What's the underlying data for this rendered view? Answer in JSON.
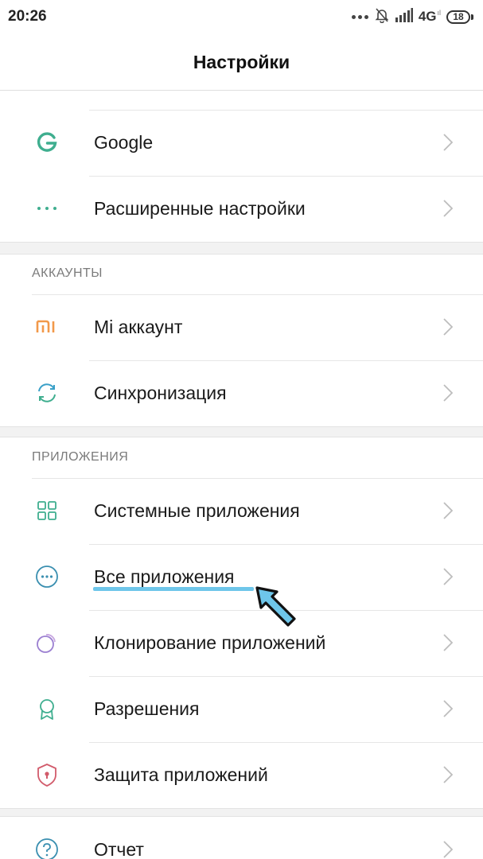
{
  "status_bar": {
    "time": "20:26",
    "network": "4G",
    "network_sub": "ıl",
    "battery": "18",
    "icons": [
      "more-dots-icon",
      "bell-muted-icon",
      "signal-icon",
      "network-4g-icon",
      "battery-icon"
    ]
  },
  "header": {
    "title": "Настройки"
  },
  "top_group": {
    "items": [
      {
        "label": "Google",
        "icon": "google-icon"
      },
      {
        "label": "Расширенные настройки",
        "icon": "more-dots-icon"
      }
    ]
  },
  "accounts": {
    "header": "АККАУНТЫ",
    "items": [
      {
        "label": "Mi аккаунт",
        "icon": "mi-logo-icon"
      },
      {
        "label": "Синхронизация",
        "icon": "sync-icon"
      }
    ]
  },
  "apps": {
    "header": "ПРИЛОЖЕНИЯ",
    "items": [
      {
        "label": "Системные приложения",
        "icon": "grid-apps-icon"
      },
      {
        "label": "Все приложения",
        "icon": "circle-dots-icon"
      },
      {
        "label": "Клонирование приложений",
        "icon": "dual-circle-icon"
      },
      {
        "label": "Разрешения",
        "icon": "badge-icon"
      },
      {
        "label": "Защита приложений",
        "icon": "shield-lock-icon"
      }
    ]
  },
  "bottom_group": {
    "items": [
      {
        "label": "Отчет",
        "icon": "help-circle-icon"
      }
    ]
  },
  "colors": {
    "accent_green": "#3fae8f",
    "mi_orange": "#f2994a",
    "highlight_blue": "#6ec6ea",
    "section_header": "#7b7b7b"
  }
}
